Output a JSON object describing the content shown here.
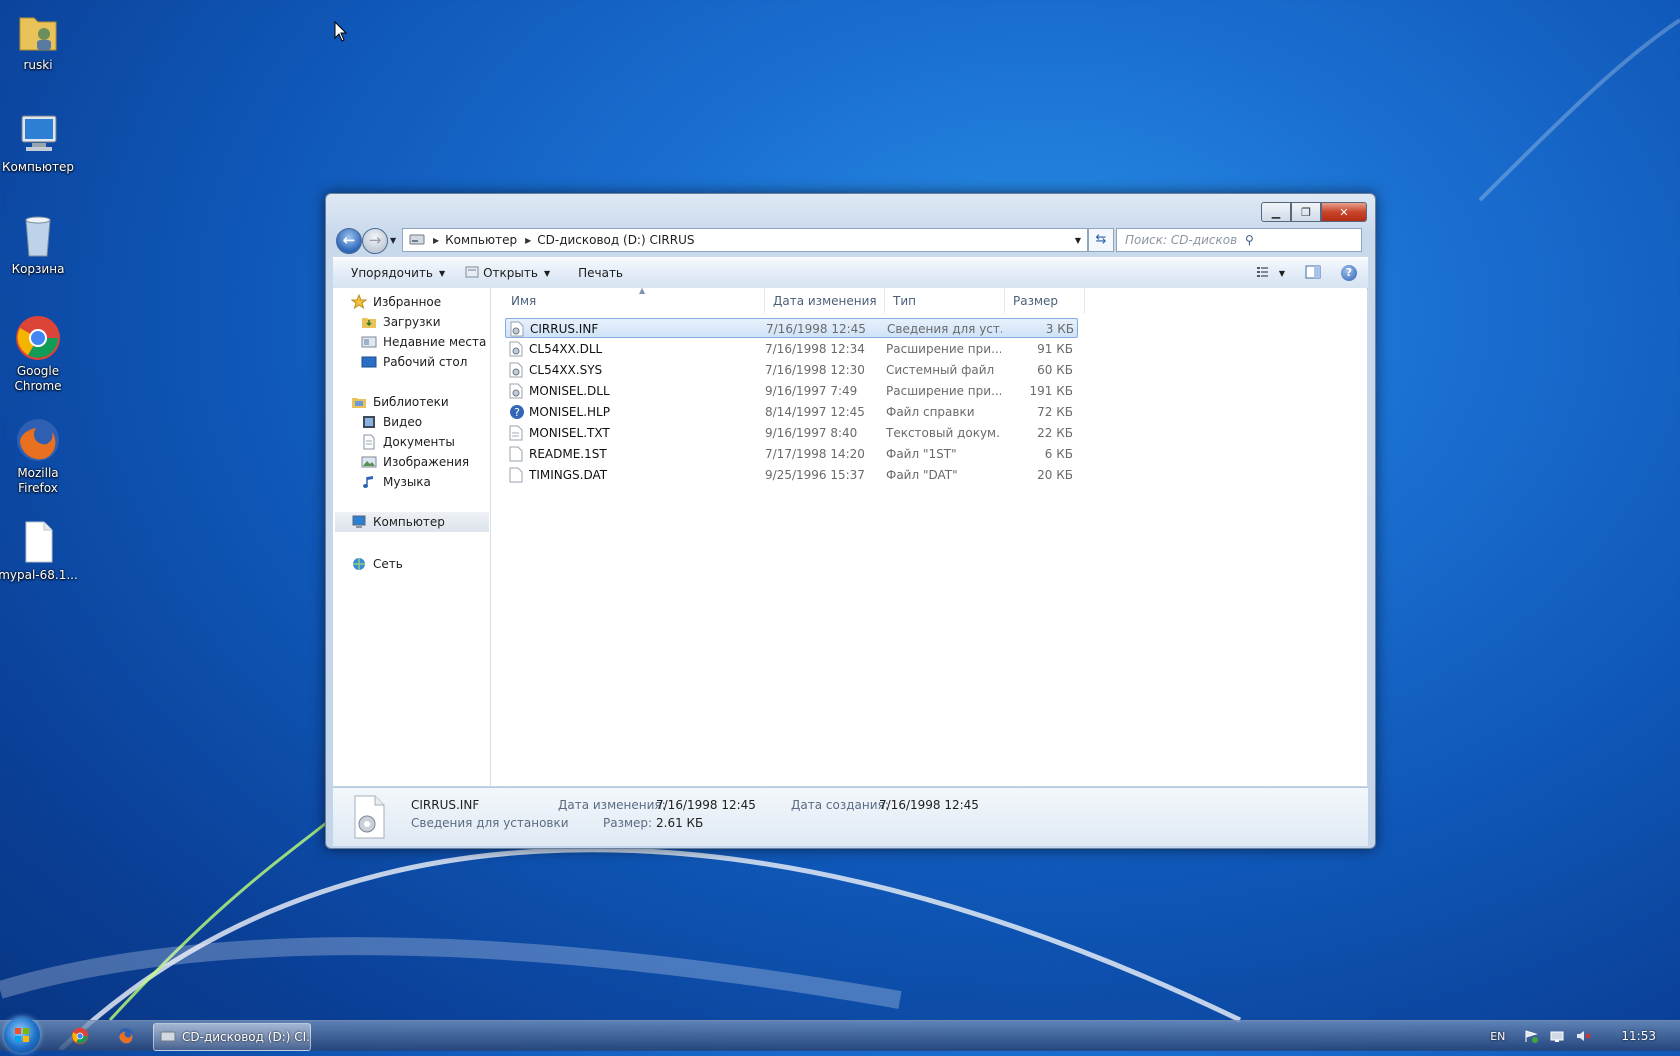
{
  "desktop": {
    "icons": [
      {
        "label": "ruski",
        "icon": "user-folder-icon"
      },
      {
        "label": "Компьютер",
        "icon": "computer-icon"
      },
      {
        "label": "Корзина",
        "icon": "recycle-bin-icon"
      },
      {
        "label": "Google Chrome",
        "icon": "chrome-icon"
      },
      {
        "label": "Mozilla Firefox",
        "icon": "firefox-icon"
      },
      {
        "label": "mypal-68.1...",
        "icon": "file-icon"
      }
    ]
  },
  "window": {
    "breadcrumb": [
      "Компьютер",
      "CD-дисковод (D:) CIRRUS"
    ],
    "search_placeholder": "Поиск: CD-дисковод (D:) CIRRUS",
    "toolbar": {
      "organize": "Упорядочить",
      "open": "Открыть",
      "print": "Печать"
    },
    "nav": {
      "favorites": "Избранное",
      "downloads": "Загрузки",
      "recent": "Недавние места",
      "desktop": "Рабочий стол",
      "libraries": "Библиотеки",
      "video": "Видео",
      "documents": "Документы",
      "images": "Изображения",
      "music": "Музыка",
      "computer": "Компьютер",
      "network": "Сеть"
    },
    "columns": {
      "name": "Имя",
      "modified": "Дата изменения",
      "type": "Тип",
      "size": "Размер"
    },
    "files": [
      {
        "name": "CIRRUS.INF",
        "modified": "7/16/1998 12:45",
        "type": "Сведения для уст...",
        "size": "3 КБ",
        "icon": "setup-info-icon",
        "selected": true
      },
      {
        "name": "CL54XX.DLL",
        "modified": "7/16/1998 12:34",
        "type": "Расширение при...",
        "size": "91 КБ",
        "icon": "dll-icon"
      },
      {
        "name": "CL54XX.SYS",
        "modified": "7/16/1998 12:30",
        "type": "Системный файл",
        "size": "60 КБ",
        "icon": "system-file-icon"
      },
      {
        "name": "MONISEL.DLL",
        "modified": "9/16/1997 7:49",
        "type": "Расширение при...",
        "size": "191 КБ",
        "icon": "dll-icon"
      },
      {
        "name": "MONISEL.HLP",
        "modified": "8/14/1997 12:45",
        "type": "Файл справки",
        "size": "72 КБ",
        "icon": "help-file-icon"
      },
      {
        "name": "MONISEL.TXT",
        "modified": "9/16/1997 8:40",
        "type": "Текстовый докум...",
        "size": "22 КБ",
        "icon": "text-file-icon"
      },
      {
        "name": "README.1ST",
        "modified": "7/17/1998 14:20",
        "type": "Файл \"1ST\"",
        "size": "6 КБ",
        "icon": "blank-file-icon"
      },
      {
        "name": "TIMINGS.DAT",
        "modified": "9/25/1996 15:37",
        "type": "Файл \"DAT\"",
        "size": "20 КБ",
        "icon": "blank-file-icon"
      }
    ],
    "details": {
      "name": "CIRRUS.INF",
      "type": "Сведения для установки",
      "modified_label": "Дата изменения:",
      "modified_value": "7/16/1998 12:45",
      "size_label": "Размер:",
      "size_value": "2.61 КБ",
      "created_label": "Дата создания:",
      "created_value": "7/16/1998 12:45"
    }
  },
  "taskbar": {
    "task_label": "CD-дисковод (D:) CI...",
    "lang": "EN",
    "clock": "11:53"
  },
  "colors": {
    "desktop": "#0f57b7",
    "selection": "#cfe2f8",
    "selection_border": "#84acdd"
  }
}
